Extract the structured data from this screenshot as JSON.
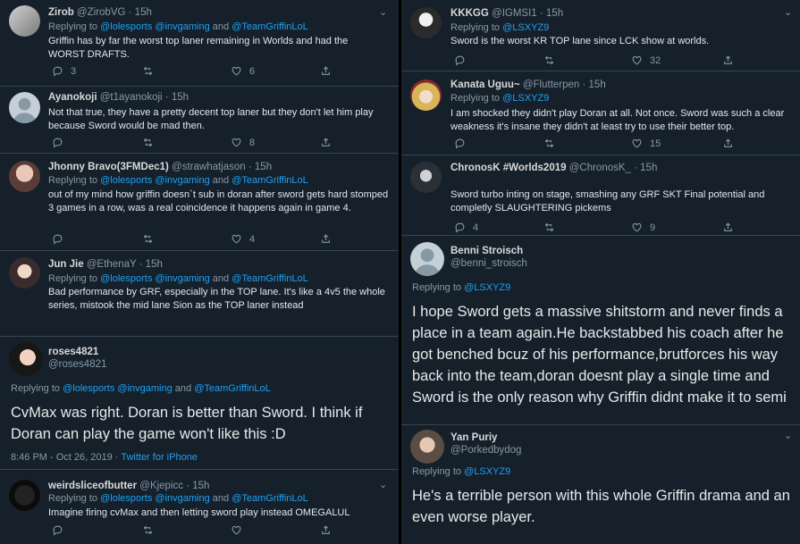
{
  "left": [
    {
      "name": "Zirob",
      "handle": "@ZirobVG",
      "time": "· 15h",
      "replying": [
        "@lolesports",
        "@invgaming",
        "@TeamGriffinLoL"
      ],
      "text": "Griffin has by far the worst top laner remaining in Worlds and had the WORST DRAFTS.",
      "replies": "3",
      "retweets": "",
      "likes": "6"
    },
    {
      "name": "Ayanokoji",
      "handle": "@t1ayanokoji",
      "time": "· 15h",
      "text": "Not that true, they have a pretty decent top laner but they don't let him play because Sword would be mad then.",
      "replies": "",
      "retweets": "",
      "likes": "8"
    },
    {
      "name": "Jhonny Bravo(3FMDec1)",
      "handle": "@strawhatjason",
      "time": "· 15h",
      "replying": [
        "@lolesports",
        "@invgaming",
        "@TeamGriffinLoL"
      ],
      "text": "out of my mind how griffin doesn`t sub in doran after sword gets hard stomped 3 games in a row, was a real coincidence it happens again in game 4.",
      "replies": "",
      "retweets": "",
      "likes": "4"
    },
    {
      "name": "Jun Jie",
      "handle": "@EthenaY",
      "time": "· 15h",
      "replying": [
        "@lolesports",
        "@invgaming",
        "@TeamGriffinLoL"
      ],
      "text": "Bad performance by GRF, especially in the TOP lane. It's like a 4v5 the whole series, mistook the mid lane Sion as the TOP laner instead"
    },
    {
      "name": "roses4821",
      "handle": "@roses4821",
      "replying": [
        "@lolesports",
        "@invgaming",
        "@TeamGriffinLoL"
      ],
      "text": "CvMax was right. Doran is better than Sword. I think if Doran can play the game won't like this :D",
      "timestamp": "8:46 PM - Oct 26, 2019",
      "source": "Twitter for iPhone"
    },
    {
      "name": "weirdsliceofbutter",
      "handle": "@Kjepicc",
      "time": "· 15h",
      "replying": [
        "@lolesports",
        "@invgaming",
        "@TeamGriffinLoL"
      ],
      "text": "Imagine firing cvMax and then letting sword play instead OMEGALUL",
      "replies": "",
      "retweets": "",
      "likes": ""
    }
  ],
  "right": [
    {
      "name": "KKKGG",
      "handle": "@IGMSI1",
      "time": "· 15h",
      "replying": [
        "@LSXYZ9"
      ],
      "text": "Sword is the worst KR TOP lane since LCK show at worlds.",
      "replies": "",
      "retweets": "",
      "likes": "32"
    },
    {
      "name": "Kanata Uguu~",
      "handle": "@Flutterpen",
      "time": "· 15h",
      "replying": [
        "@LSXYZ9"
      ],
      "text": "I am shocked they didn't play Doran at all. Not once. Sword was such a clear weakness it's insane they didn't at least try to use their better top.",
      "replies": "",
      "retweets": "",
      "likes": "15"
    },
    {
      "name": "ChronosK #Worlds2019",
      "handle": "@ChronosK_",
      "time": "· 15h",
      "text": "Sword turbo inting on stage, smashing any GRF SKT Final potential and completly SLAUGHTERING pickems",
      "replies": "4",
      "retweets": "",
      "likes": "9"
    },
    {
      "name": "Benni Stroisch",
      "handle": "@benni_stroisch",
      "replying": [
        "@LSXYZ9"
      ],
      "text": "I hope Sword gets a massive shitstorm and never finds a place in a team again.He backstabbed his coach after he got benched bcuz of his performance,brutforces his way back into the team,doran doesnt play a single time and Sword is the only reason why Griffin didnt make it to semi"
    },
    {
      "name": "Yan Puriy",
      "handle": "@Porkedbydog",
      "replying": [
        "@LSXYZ9"
      ],
      "text": "He's a terrible person with this whole Griffin drama and an even worse player."
    }
  ],
  "labels": {
    "replying_to": "Replying to",
    "and": "and"
  },
  "colors": {
    "background": "#15202b",
    "link": "#1da1f2",
    "muted": "#8899a6",
    "border": "#38444d"
  }
}
